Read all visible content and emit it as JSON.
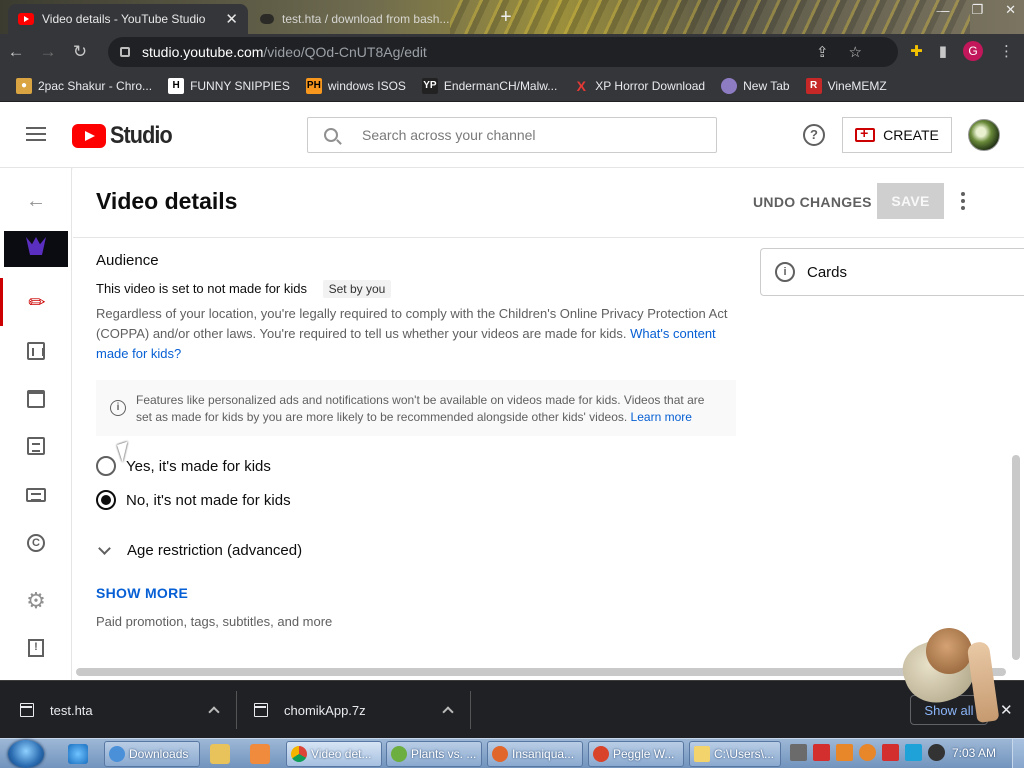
{
  "browser": {
    "tabs": [
      {
        "title": "Video details - YouTube Studio",
        "active": true
      },
      {
        "title": "test.hta / download from bash...",
        "active": false
      }
    ],
    "url_domain": "studio.youtube.com",
    "url_path": "/video/QOd-CnUT8Ag/edit",
    "profile_initial": "G",
    "bookmarks": [
      {
        "label": "2pac Shakur - Chro...",
        "icon": "image-icon",
        "color": "#d9a441"
      },
      {
        "label": "FUNNY SNIPPIES",
        "icon": "H",
        "color": "#ffffff"
      },
      {
        "label": "windows ISOS",
        "icon": "PH",
        "color": "#f7971d"
      },
      {
        "label": "EndermanCH/Malw...",
        "icon": "YP",
        "color": "#222222"
      },
      {
        "label": "XP Horror Download",
        "icon": "X",
        "color": "#e53935"
      },
      {
        "label": "New Tab",
        "icon": "globe-icon",
        "color": "#8e7cc3"
      },
      {
        "label": "VineMEMZ",
        "icon": "R",
        "color": "#c62828"
      }
    ]
  },
  "header": {
    "logo_text": "Studio",
    "search_placeholder": "Search across your channel",
    "help_label": "?",
    "create_label": "CREATE"
  },
  "page": {
    "title": "Video details",
    "undo_label": "UNDO CHANGES",
    "save_label": "SAVE"
  },
  "audience": {
    "heading": "Audience",
    "status": "This video is set to not made for kids",
    "chip": "Set by you",
    "paragraph": "Regardless of your location, you're legally required to comply with the Children's Online Privacy Protection Act (COPPA) and/or other laws. You're required to tell us whether your videos are made for kids.",
    "paragraph_link": "What's content made for kids?",
    "info_text": "Features like personalized ads and notifications won't be available on videos made for kids. Videos that are set as made for kids by you are more likely to be recommended alongside other kids' videos.",
    "info_link": "Learn more",
    "option_yes": "Yes, it's made for kids",
    "option_no": "No, it's not made for kids",
    "selected": "no",
    "age_restriction": "Age restriction (advanced)",
    "show_more": "SHOW MORE",
    "show_more_note": "Paid promotion, tags, subtitles, and more"
  },
  "side_panel": {
    "cards_label": "Cards"
  },
  "downloads": [
    {
      "filename": "test.hta"
    },
    {
      "filename": "chomikApp.7z"
    }
  ],
  "downloads_show_all": "Show all",
  "taskbar": {
    "buttons": [
      "Downloads",
      "Video det...",
      "Plants vs. ...",
      "Insaniqua...",
      "Peggle W...",
      "C:\\Users\\..."
    ],
    "clock": "7:03 AM"
  },
  "colors": {
    "accent_red": "#cc0000",
    "link_blue": "#065fd4",
    "chrome_dark": "#35363a"
  }
}
